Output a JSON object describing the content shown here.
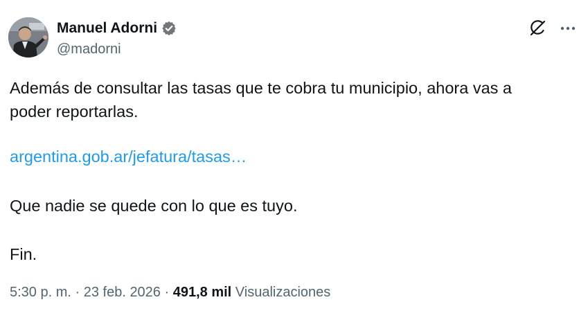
{
  "author": {
    "display_name": "Manuel Adorni",
    "handle": "@madorni",
    "verified": true
  },
  "tweet": {
    "line1": "Además de consultar las tasas que te cobra tu municipio, ahora vas a",
    "line2": "poder reportarlas.",
    "link": "argentina.gob.ar/jefatura/tasas…",
    "line3": "Que nadie se quede con lo que es tuyo.",
    "line4": "Fin."
  },
  "meta": {
    "time": "5:30 p. m.",
    "sep1": " · ",
    "date": "23 feb. 2026",
    "sep2": " · ",
    "views_count": "491,8 mil",
    "views_label": " Visualizaciones"
  },
  "icons": {
    "verified": "verified-badge-icon",
    "grok": "grok-icon",
    "more": "more-dots-icon"
  },
  "colors": {
    "accent": "#1d9bf0",
    "text": "#0f1419",
    "secondary": "#536471"
  }
}
